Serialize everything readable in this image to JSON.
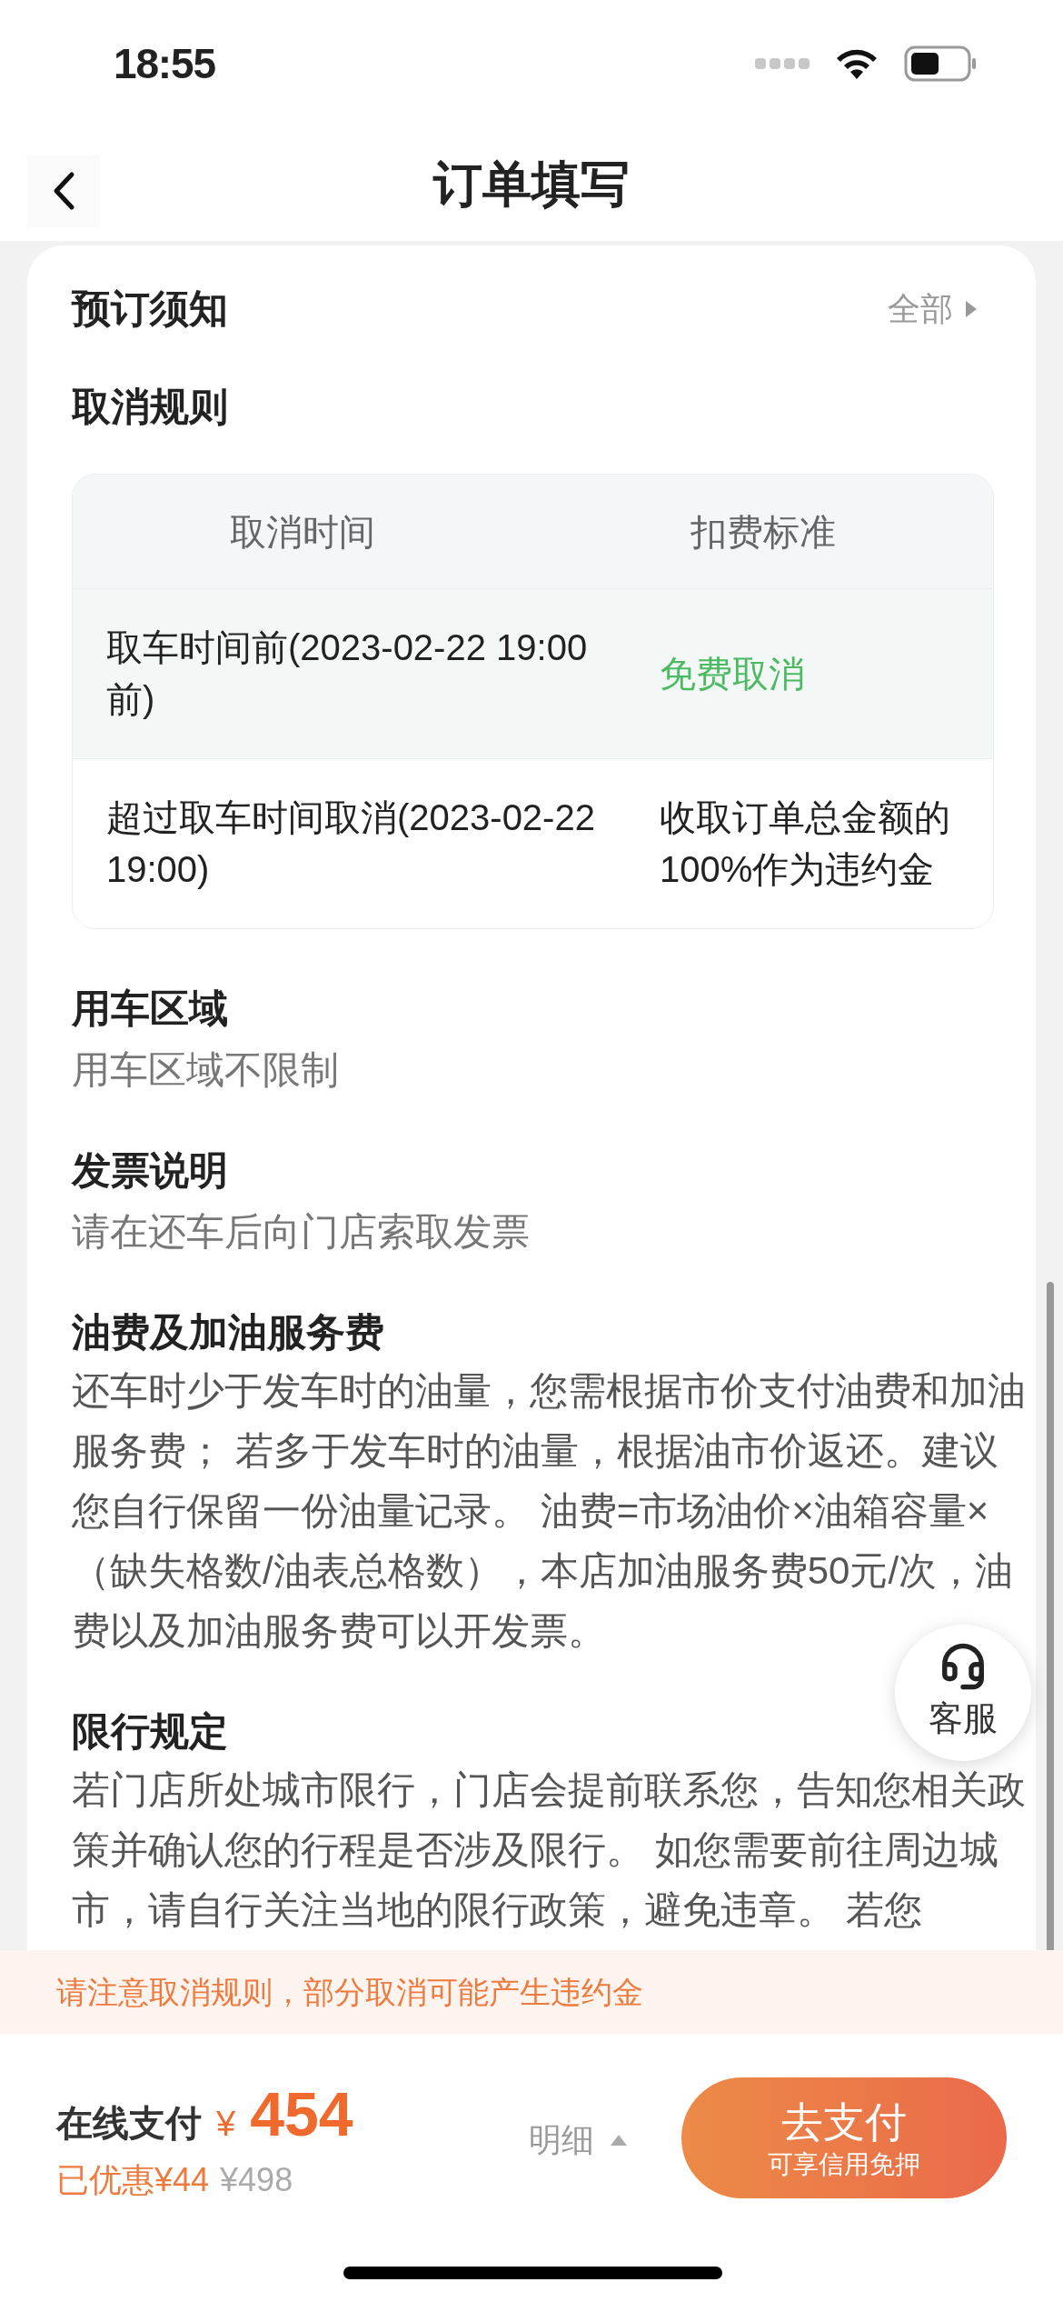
{
  "status_bar": {
    "time": "18:55"
  },
  "nav": {
    "title": "订单填写"
  },
  "notice": {
    "title": "预订须知",
    "more": "全部"
  },
  "cancel_rules": {
    "title": "取消规则",
    "columns": [
      "取消时间",
      "扣费标准"
    ],
    "rows": [
      {
        "time": "取车时间前(2023-02-22 19:00前)",
        "fee": "免费取消",
        "kind": "free"
      },
      {
        "time": "超过取车时间取消(2023-02-22 19:00)",
        "fee": "收取订单总金额的100%作为违约金",
        "kind": "charge"
      }
    ]
  },
  "sections": [
    {
      "title": "用车区域",
      "body": "用车区域不限制",
      "kind": "short"
    },
    {
      "title": "发票说明",
      "body": "请在还车后向门店索取发票",
      "kind": "short"
    },
    {
      "title": "油费及加油服务费",
      "body": "还车时少于发车时的油量，您需根据市价支付油费和加油服务费； 若多于发车时的油量，根据油市价返还。建议您自行保留一份油量记录。 油费=市场油价×油箱容量×（缺失格数/油表总格数），本店加油服务费50元/次，油费以及加油服务费可以开发票。",
      "kind": "paragraph"
    },
    {
      "title": "限行规定",
      "body": "若门店所处城市限行，门店会提前联系您，告知您相关政策并确认您的行程是否涉及限行。 如您需要前往周边城市，请自行关注当地的限行政策，避免违章。 若您",
      "kind": "paragraph"
    }
  ],
  "service_button": {
    "label": "客服"
  },
  "warning": "请注意取消规则，部分取消可能产生违约金",
  "payment": {
    "label": "在线支付",
    "currency": "¥",
    "amount": "454",
    "discount": "已优惠¥44",
    "original": "¥498",
    "details": "明细",
    "pay_button": {
      "label": "去支付",
      "sublabel": "可享信用免押"
    }
  }
}
